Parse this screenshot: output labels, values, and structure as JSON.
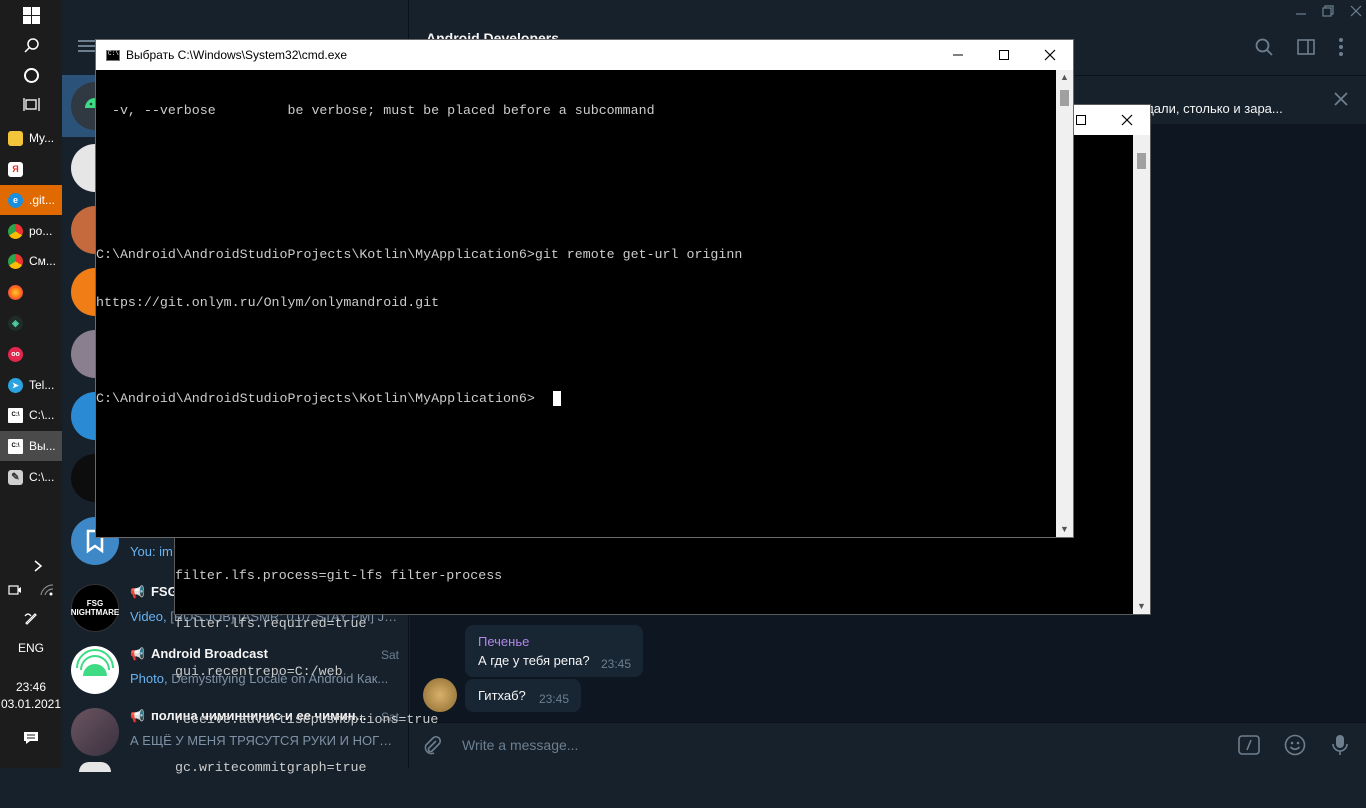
{
  "taskbar": {
    "apps": [
      {
        "label": "My...",
        "color": "#f3c53a",
        "glyph": ""
      },
      {
        "label": "",
        "color": "#ffffff",
        "glyph": "Я",
        "glyph_color": "#e42b23"
      },
      {
        "label": ".git...",
        "color": "#1a8fe0",
        "glyph": "e"
      },
      {
        "label": "po...",
        "color": "#ffffff",
        "glyph": "●",
        "glyph_color": "#2aa54b"
      },
      {
        "label": "См...",
        "color": "#ffffff",
        "glyph": "●",
        "glyph_color": "#2aa54b"
      },
      {
        "label": "",
        "color": "#ff7300",
        "glyph": "◉"
      },
      {
        "label": "",
        "color": "#1f2d2a",
        "glyph": "◈",
        "glyph_color": "#4fd1a1"
      },
      {
        "label": "",
        "color": "#e3264b",
        "glyph": "oo"
      },
      {
        "label": "Tel...",
        "color": "#2aa3e0",
        "glyph": "➤"
      },
      {
        "label": "C:\\...",
        "color": "#3a3a3a",
        "glyph": "C:\\"
      },
      {
        "label": "Вы...",
        "color": "#3a3a3a",
        "glyph": "C:\\"
      },
      {
        "label": "C:\\...",
        "color": "#d0d0d0",
        "glyph": "✎",
        "glyph_color": "#333333"
      }
    ],
    "lang": "ENG",
    "time": "23:46",
    "date": "03.01.2021"
  },
  "telegram": {
    "header_title": "Android Developers",
    "pinned_text": "продали, столько и зара...",
    "chats": [
      {
        "name": "FSG",
        "time": "",
        "preview_highlight": "Video,",
        "preview": " [ROS JOB] [ASMR: 0.07 STAY PM] JH...",
        "avatar": "#000000",
        "avatar_text": "FSG NIGHTMARE",
        "channel": true
      },
      {
        "name": "Android Broadcast",
        "time": "Sat",
        "preview_highlight": "Photo,",
        "preview": " Demystifying Locale on Android  Как...",
        "avatar": "#ffffff",
        "avatar_text": "",
        "channel": true
      },
      {
        "name": "полина чиминнинис и ее чимин...",
        "time": "Sat",
        "preview_highlight": "",
        "preview": "А ЕЩЁ У МЕНЯ ТРЯСУТСЯ РУКИ И НОГИ П...",
        "avatar": "#5a4a5a",
        "avatar_text": "",
        "channel": true
      }
    ],
    "saved_preview": "You: im",
    "messages": [
      {
        "author": "Печенье",
        "text": "А где у тебя репа?",
        "time": "23:45"
      },
      {
        "author": "",
        "text": "Гитхаб?",
        "time": "23:45"
      }
    ],
    "input_placeholder": "Write a message..."
  },
  "cmd_front": {
    "title": "Выбрать C:\\Windows\\System32\\cmd.exe",
    "lines": [
      "  -v, --verbose         be verbose; must be placed before a subcommand",
      "",
      "",
      "C:\\Android\\AndroidStudioProjects\\Kotlin\\MyApplication6>git remote get-url originn",
      "https://git.onlym.ru/Onlym/onlymandroid.git",
      "",
      "C:\\Android\\AndroidStudioProjects\\Kotlin\\MyApplication6>"
    ]
  },
  "cmd_back": {
    "lines": [
      "filter.lfs.process=git-lfs filter-process",
      "filter.lfs.required=true",
      "gui.recentrepo=C:/web",
      "receive.advertisepushoptions=true",
      "gc.writecommitgraph=true"
    ]
  },
  "colors": {
    "tg_sidebar": "#17212b",
    "tg_chat_bg": "#0e1621",
    "accent": "#6ab3f3",
    "author": "#b187e8"
  }
}
